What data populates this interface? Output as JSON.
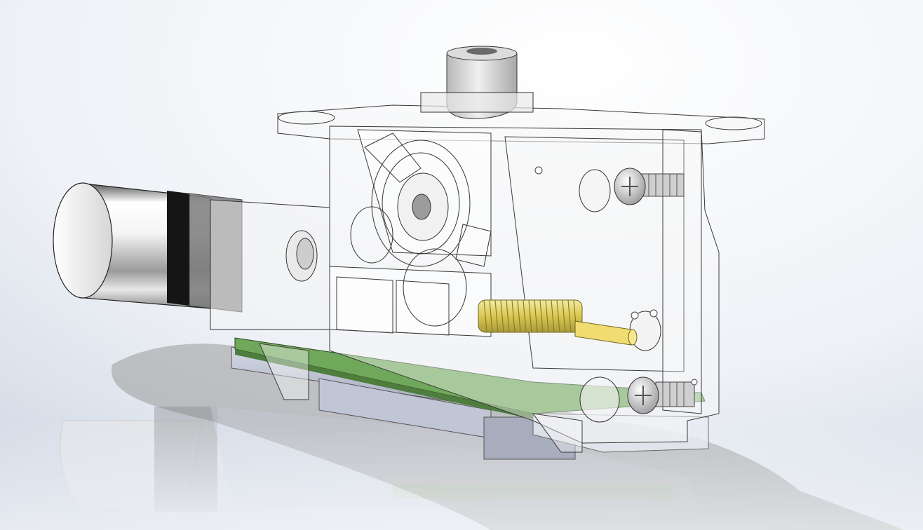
{
  "scene": {
    "subject": "transparent-servo-assembly",
    "background_colors": [
      "#ffffff",
      "#e3e8f0",
      "#c7d0df"
    ],
    "colors": {
      "housing": "#f2f2f2",
      "housing_stroke": "#3a3a3a",
      "motor_can": "#d9d9d9",
      "motor_band": "#111111",
      "pcb": "#6fa85a",
      "base_plate": "#b9bfd0",
      "spring": "#e0d060",
      "shaft": "#f0dc70",
      "screw": "#cfcfcf",
      "shadow": "#8a8a8a"
    }
  }
}
